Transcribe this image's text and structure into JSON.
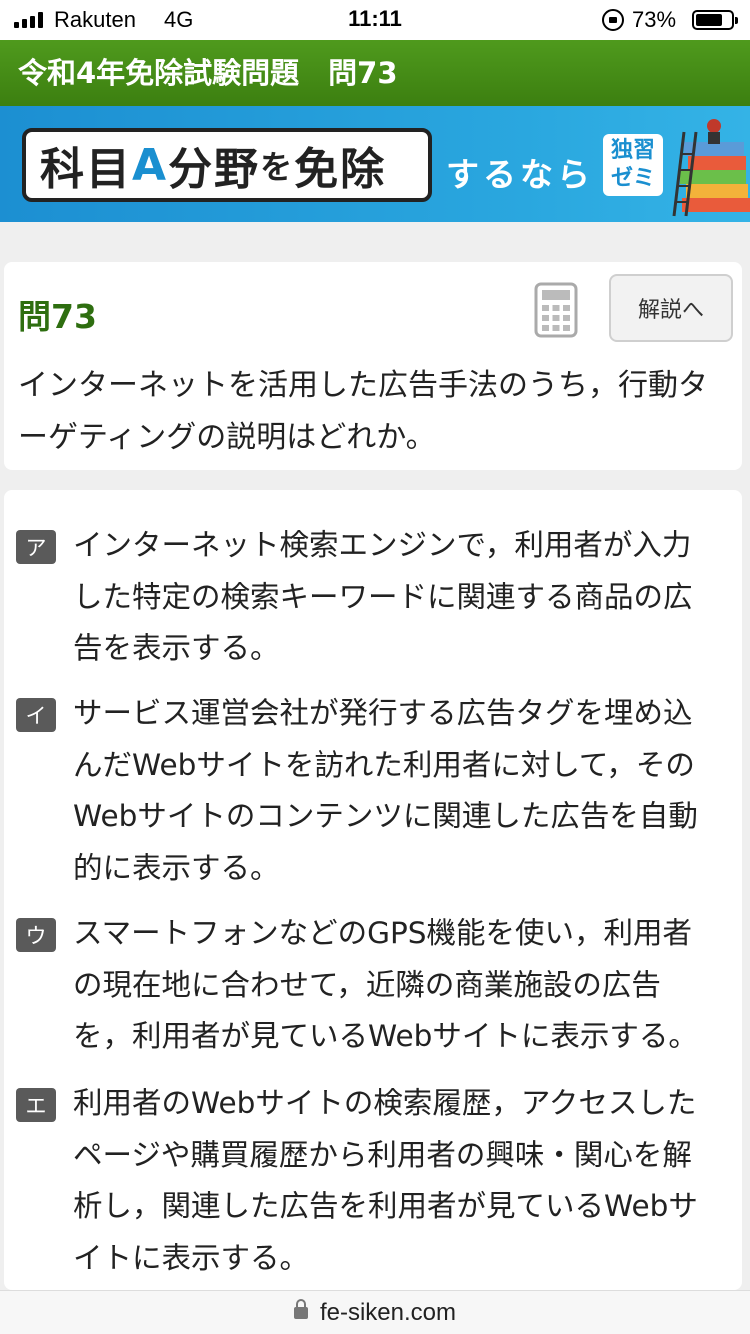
{
  "status_bar": {
    "carrier": "Rakuten",
    "network": "4G",
    "time": "11:11",
    "battery_percent": "73%"
  },
  "header": {
    "title": "令和4年免除試験問題　問73"
  },
  "banner": {
    "part1": "科目",
    "highlight": "A",
    "part2": "分野",
    "particle": "を",
    "part3": "免除",
    "suffix": "するなら",
    "badge_line1": "独習",
    "badge_line2": "ゼミ"
  },
  "question": {
    "number": "問73",
    "explain_label": "解説へ",
    "text": "インターネットを活用した広告手法のうち，行動ターゲティングの説明はどれか。"
  },
  "choices": [
    {
      "label": "ア",
      "text": "インターネット検索エンジンで，利用者が入力した特定の検索キーワードに関連する商品の広告を表示する。"
    },
    {
      "label": "イ",
      "text": "サービス運営会社が発行する広告タグを埋め込んだWebサイトを訪れた利用者に対して，そのWebサイトのコンテンツに関連した広告を自動的に表示する。"
    },
    {
      "label": "ウ",
      "text": "スマートフォンなどのGPS機能を使い，利用者の現在地に合わせて，近隣の商業施設の広告を，利用者が見ているWebサイトに表示する。"
    },
    {
      "label": "エ",
      "text": "利用者のWebサイトの検索履歴，アクセスしたページや購買履歴から利用者の興味・関心を解析し，関連した広告を利用者が見ているWebサイトに表示する。"
    }
  ],
  "url_bar": {
    "domain": "fe-siken.com"
  },
  "icons": {
    "calculator": "calculator-icon",
    "lock": "lock-icon",
    "books": "books-illustration"
  },
  "colors": {
    "header_green": "#3c7f10",
    "question_number": "#2e6e10",
    "banner_blue": "#1c8fd2",
    "choice_badge": "#5a5a5a"
  }
}
